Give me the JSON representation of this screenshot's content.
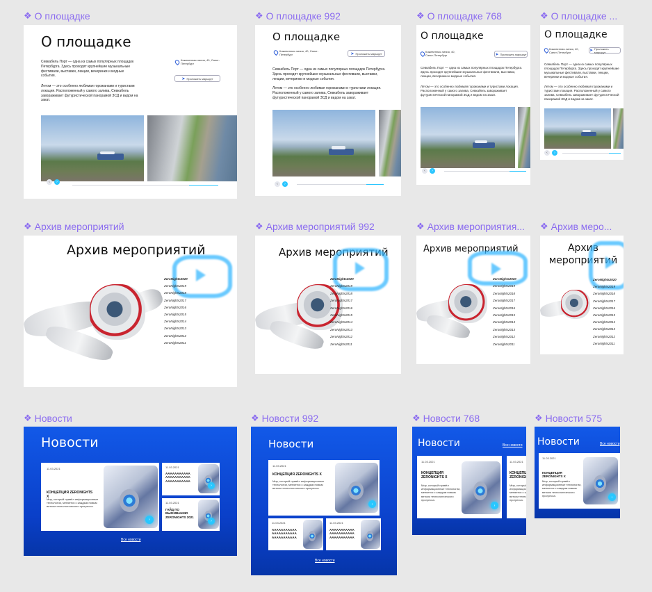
{
  "frames": [
    {
      "label": "О площадке"
    },
    {
      "label": "О площадке 992"
    },
    {
      "label": "О площадке 768"
    },
    {
      "label": "О площадке ..."
    },
    {
      "label": "Архив мероприятий"
    },
    {
      "label": "Архив мероприятий 992"
    },
    {
      "label": "Архив мероприятия..."
    },
    {
      "label": "Архив меро..."
    },
    {
      "label": "Новости"
    },
    {
      "label": "Новости 992"
    },
    {
      "label": "Новости 768"
    },
    {
      "label": "Новости 575"
    }
  ],
  "about": {
    "title": "О площадке",
    "para1": "Севкабель Порт — одна из самых популярных площадок Петербурга. Здесь проходят крупнейшие музыкальные фестивали, выставки, лекции, вечеринки и модные события.",
    "para2": "Летом — это особенно любимая горожанами и туристами локация. Расположенный у самого залива, Севкабель завораживает футуристической панорамой ЗСД и видом на закат.",
    "address": "Кожевенная линия, 40, Санкт-Петербург",
    "route": "Проложить маршрут"
  },
  "archive": {
    "title": "Архив мероприятий",
    "years": [
      "ZeroNights2020",
      "ZeroNights2019",
      "ZeroNights2018",
      "ZeroNights2017",
      "ZeroNights2016",
      "ZeroNights2015",
      "ZeroNights2014",
      "ZeroNights2013",
      "ZeroNights2012",
      "ZeroNights2011"
    ]
  },
  "news": {
    "title": "Новости",
    "all_news": "Все новости",
    "main_date": "11.03.2021",
    "main_head": "КОНЦЕПЦИЯ ZERONIGHTS X",
    "main_body": "Мир, который привёл информационные технологии, меняется с каждым новым витком технологического прогресса.",
    "side_date": "11.03.2021",
    "side_head": "ААААААААААА ААААААААААА ААААААААААА",
    "guide_date": "11.03.2021",
    "guide_head": "ГАЙД ПО ВЫЖИВАНИЮ ZERONIGHTS 2021"
  }
}
